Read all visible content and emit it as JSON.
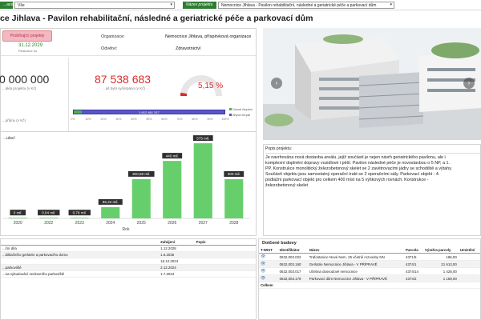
{
  "filters": {
    "label1": "...ace",
    "value1": "Vše",
    "label2": "Název projektu",
    "value2": "Nemocnice Jihlava - Pavilon rehabilitační, následné a geriatrické péče a parkovací dům"
  },
  "page_title": "ce Jihlava - Pavilon rehabilitační, následné a geriatrické péče a parkovací dům",
  "project": {
    "badge": "Probíhající projekty",
    "date": "31.12.2029",
    "date_note": "Realizace do",
    "org_label": "Organizace:",
    "org_value": "Nemocnice Jihlava, příspěvková organizace",
    "odvetvi_label": "Odvětví:",
    "odvetvi_value": "Zdravotnictví"
  },
  "kpi": {
    "total_value": "0 000 000",
    "total_label": "...ákla projektu (v Kč)",
    "drawn_value": "87 538 683",
    "drawn_label": "...aš bylo vyčerpáno (v Kč)",
    "pct_value": "5,15 %",
    "pct": 5.15,
    "left_small": "...příjmy (v Kč)"
  },
  "progress": {
    "label": "1 612 461 317",
    "legend1": "Dosud čerpání",
    "legend2": "Zbývá čerpat",
    "ticks": [
      "0%",
      "10%",
      "20%",
      "30%",
      "40%",
      "50%",
      "60%",
      "70%",
      "80%",
      "90%",
      "100%"
    ],
    "drawn_pct": 5.15
  },
  "chart_title": "...ulací",
  "chart_data": {
    "type": "bar",
    "title": "...ulací",
    "xlabel": "Rok",
    "categories": [
      "2020",
      "2022",
      "2023",
      "2024",
      "2025",
      "2026",
      "2027",
      "2028"
    ],
    "values": [
      0.0,
      0.04,
      0.76,
      86.32,
      300.59,
      440,
      575,
      300
    ],
    "data_labels": [
      "0 mil.",
      "0,04 mil.",
      "0,76 mil.",
      "86,32 mil.",
      "300,59 mil.",
      "440 mil.",
      "575 mil.",
      "300 mil."
    ],
    "ylim": [
      0,
      600
    ],
    "bar_color": "#66cf6b"
  },
  "description": {
    "title": "Popis projektu:",
    "text": "Je navrhována nová dostavba areálu, jejíž součástí je nejen návrh geriatrického pavilonu, ale i komplexní doplnění dopravy vozidlové i pěší. Pavilon následné péče je novostavbou o 5 NP, a 1. PP. Konstrukce monolitický železobetonový skelet se 2 zavětrovacími jádry se schodiště a výtahy. Součástí objektu jsou samostatný operační trakt se 2 operačními sály. Parkovací objekt - 4. podlažní parkovací objekt pro celkem 400 míst na 5 výškových rovnách. Konstrukce - železobetonový skelet"
  },
  "left_table": {
    "headers": [
      "",
      "Zahájení",
      "Popis"
    ],
    "rows": [
      [
        "...ční díla",
        "1.12.2028",
        ""
      ],
      [
        "...bilitačního gerlatrie a parkovacího domu",
        "1.6.2025",
        ""
      ],
      [
        "",
        "16.12.2024",
        ""
      ],
      [
        "...parkoviště",
        "2.12.2024",
        ""
      ],
      [
        "...na vybudování venkovního parkoviště",
        "1.7.2024",
        ""
      ]
    ]
  },
  "right_table": {
    "title": "Dotčené budovy",
    "headers": [
      "T-WIST",
      "Identifikátor",
      "Název",
      "Parcela",
      "Výměra parcely",
      "Umístění"
    ],
    "rows": [
      [
        "👁",
        "0632,003.022",
        "Trafostanice Nové Nem. 25 včetně rozvodny NN",
        "4371/5",
        "186,00",
        ""
      ],
      [
        "👁",
        "0632,003.160",
        "Gerlatrie Nemocnice Jihlava - V PŘÍPRAVĚ",
        "4374/1",
        "21 613,00",
        ""
      ],
      [
        "👁",
        "0632,003.017",
        "Učebna dosvodové nemocnice",
        "4374/14",
        "1 428,00",
        ""
      ],
      [
        "👁",
        "0632,003.179",
        "Parkovací dům Nemocnice Jihlava - V PŘÍPRAVĚ",
        "4374/2",
        "1 159,00",
        ""
      ]
    ],
    "total_label": "Celkem"
  }
}
